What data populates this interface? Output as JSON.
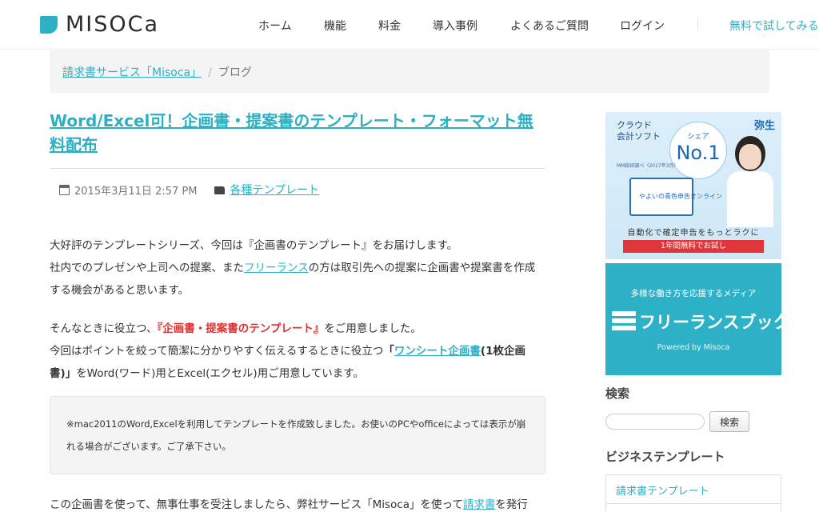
{
  "header": {
    "logo_text": "MISOCa",
    "nav": [
      {
        "label": "ホーム"
      },
      {
        "label": "機能"
      },
      {
        "label": "料金"
      },
      {
        "label": "導入事例"
      },
      {
        "label": "よくあるご質問"
      },
      {
        "label": "ログイン"
      }
    ],
    "cta": "無料で試してみる"
  },
  "breadcrumb": {
    "home": "請求書サービス「Misoca」",
    "separator": "/",
    "current": "ブログ"
  },
  "post": {
    "title": "Word/Excel可！企画書・提案書のテンプレート・フォーマット無料配布",
    "date": "2015年3月11日 2:57 PM",
    "category": "各種テンプレート",
    "p1_line1": "大好評のテンプレートシリーズ、今回は『企画書のテンプレート』をお届けします。",
    "p1_line2_a": "社内でのプレゼンや上司への提案、また",
    "p1_line2_link": "フリーランス",
    "p1_line2_b": "の方は取引先への提案に企画書や提案書を作成する機会があると思います。",
    "p2_a": "そんなときに役立つ、",
    "p2_red": "『企画書・提案書のテンプレート』",
    "p2_b": "をご用意しました。",
    "p3_a": "今回はポイントを絞って簡潔に分かりやすく伝えるするときに役立つ",
    "p3_bold_open": "「",
    "p3_link": "ワンシート企画書",
    "p3_bold_close": "(1枚企画書)」",
    "p3_b": "をWord(ワード)用とExcel(エクセル)用ご用意しています。",
    "notice": "※mac2011のWord,Excelを利用してテンプレートを作成致しました。お使いのPCやofficeによっては表示が崩れる場合がございます。ご了承下さい。",
    "last_a": "この企画書を使って、無事仕事を受注しましたら、弊社サービス「Misoca」を使って",
    "last_link": "請求書",
    "last_b": "を発行"
  },
  "sidebar": {
    "ad1": {
      "brand": "弥生",
      "cloud": "クラウド",
      "product": "会計ソフト",
      "share": "シェア",
      "rank": "No.1",
      "note": "MM総研調べ（2017年3月）",
      "device_label": "やよいの青色申告オンライン",
      "tagline": "自動化で確定申告をもっとラクに",
      "button": "1年間無料でお試し"
    },
    "ad2": {
      "subtitle": "多様な働き方を応援するメディア",
      "title": "フリーランスブック",
      "powered": "Powered by Misoca"
    },
    "search_title": "検索",
    "search_button": "検索",
    "business_title": "ビジネステンプレート",
    "business_items": [
      {
        "label": "請求書テンプレート"
      },
      {
        "label": ""
      }
    ]
  },
  "colors": {
    "accent": "#2bb0c4",
    "red": "#e03030",
    "ad_blue": "#1a68b5"
  }
}
